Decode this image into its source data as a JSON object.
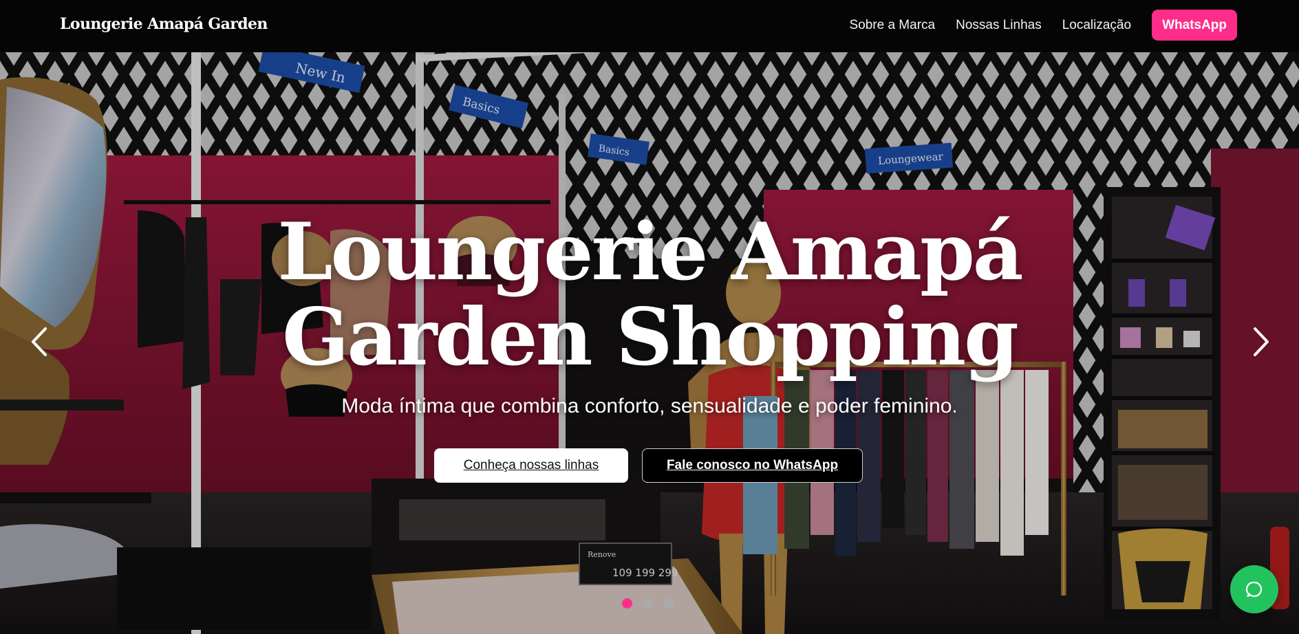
{
  "header": {
    "brand": "Loungerie Amapá Garden",
    "nav": {
      "about": "Sobre a Marca",
      "lines": "Nossas Linhas",
      "location": "Localização",
      "whatsapp": "WhatsApp"
    }
  },
  "hero": {
    "title": "Loungerie Amapá Garden Shopping",
    "subtitle": "Moda íntima que combina conforto, sensualidade e poder feminino.",
    "cta_primary": "Conheça nossas linhas",
    "cta_secondary": "Fale conosco no WhatsApp",
    "slides_total": 3,
    "active_slide": 1,
    "background": {
      "store_signs": [
        "New In",
        "Basics",
        "Basics",
        "Loungewear"
      ],
      "price_sign": {
        "title": "Renove",
        "prices": [
          "109",
          "199",
          "299"
        ]
      }
    }
  },
  "floating": {
    "icon": "whatsapp-chat-icon"
  },
  "colors": {
    "accent": "#ff2d8a",
    "whatsapp_green": "#22c35e",
    "header_bg": "#050505",
    "wall_red": "#8e1737"
  }
}
